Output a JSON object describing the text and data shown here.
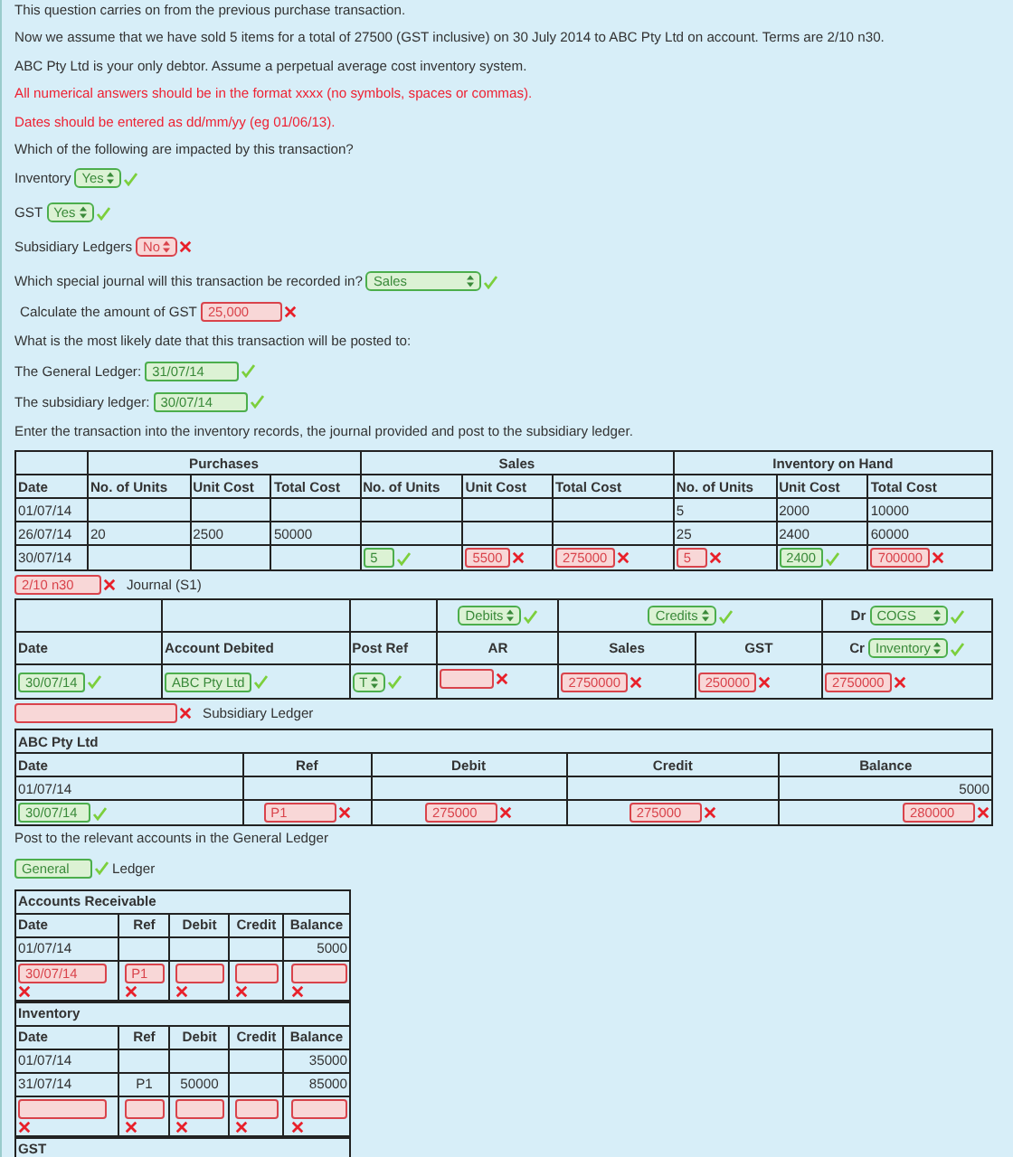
{
  "intro": [
    {
      "text": "This question carries on from the previous purchase transaction.",
      "kind": "plain"
    },
    {
      "text": "Now we assume that we have sold 5 items for a total of 27500 (GST inclusive) on 30 July 2014 to ABC Pty Ltd on account. Terms are 2/10 n30.",
      "kind": "plain"
    },
    {
      "text": "ABC Pty Ltd is your only debtor. Assume a perpetual average cost inventory system.",
      "kind": "plain"
    },
    {
      "text": "All numerical answers should be in the format xxxx (no symbols, spaces or commas).",
      "kind": "warning"
    },
    {
      "text": "Dates should be entered as dd/mm/yy (eg 01/06/13).",
      "kind": "warning"
    },
    {
      "text": "Which of the following are impacted by this transaction?",
      "kind": "plain"
    }
  ],
  "impacts": [
    {
      "label": "Inventory",
      "answer": {
        "kind": "select",
        "value": "Yes",
        "correct": true
      }
    },
    {
      "label": "GST",
      "answer": {
        "kind": "select",
        "value": "Yes",
        "correct": true
      }
    },
    {
      "label": "Subsidiary Ledgers",
      "answer": {
        "kind": "select",
        "value": "No",
        "correct": false
      }
    }
  ],
  "journal_question": {
    "label": "Which special journal will this transaction be recorded in?",
    "answer": {
      "kind": "select",
      "value": "Sales",
      "correct": true
    }
  },
  "gst_question": {
    "label": "Calculate the amount of GST",
    "answer": {
      "kind": "input",
      "value": "25,000",
      "correct": false
    }
  },
  "date_question": "What is the most likely date that this transaction will be posted to:",
  "posting_dates": [
    {
      "label": "The General Ledger:",
      "answer": {
        "kind": "input",
        "value": "31/07/14",
        "correct": true
      }
    },
    {
      "label": "The subsidiary ledger:",
      "answer": {
        "kind": "input",
        "value": "30/07/14",
        "correct": true
      }
    }
  ],
  "instruction": "Enter the transaction into the inventory records, the journal provided and post to the subsidiary ledger.",
  "inventory_table": {
    "groups": [
      "Purchases",
      "Sales",
      "Inventory on Hand"
    ],
    "columns": [
      "Date",
      "No. of Units",
      "Unit Cost",
      "Total Cost",
      "No. of Units",
      "Unit Cost",
      "Total Cost",
      "No. of Units",
      "Unit Cost",
      "Total Cost"
    ],
    "rows": [
      [
        "01/07/14",
        null,
        null,
        null,
        null,
        null,
        null,
        "5",
        "2000",
        "10000"
      ],
      [
        "26/07/14",
        "20",
        "2500",
        "50000",
        null,
        null,
        null,
        "25",
        "2400",
        "60000"
      ],
      [
        "30/07/14",
        null,
        null,
        null,
        {
          "kind": "input",
          "value": "5",
          "correct": true
        },
        {
          "kind": "input",
          "value": "5500",
          "correct": false
        },
        {
          "kind": "input",
          "value": "275000",
          "correct": false
        },
        {
          "kind": "input",
          "value": "5",
          "correct": false
        },
        {
          "kind": "input",
          "value": "2400",
          "correct": true
        },
        {
          "kind": "input",
          "value": "700000",
          "correct": false
        }
      ]
    ]
  },
  "terms_answer": {
    "kind": "input",
    "value": "2/10 n30",
    "correct": false
  },
  "journal_label": "Journal (S1)",
  "journal": {
    "columns": [
      "Date",
      "Account Debited",
      "Post Ref",
      "AR",
      "Sales",
      "GST"
    ],
    "debit_group": {
      "kind": "select",
      "value": "Debits",
      "correct": true
    },
    "credit_group": {
      "kind": "select",
      "value": "Credits",
      "correct": true
    },
    "dr_label": "Dr",
    "dr_answer": {
      "kind": "select",
      "value": "COGS",
      "correct": true
    },
    "cr_label": "Cr",
    "cr_answer": {
      "kind": "select",
      "value": "Inventory",
      "correct": true
    },
    "row": [
      {
        "kind": "input",
        "value": "30/07/14",
        "correct": true
      },
      {
        "kind": "input",
        "value": "ABC Pty Ltd",
        "correct": true
      },
      {
        "kind": "select",
        "value": "T",
        "correct": true
      },
      {
        "kind": "input",
        "correct": false
      },
      {
        "kind": "input",
        "value": "2750000",
        "correct": false
      },
      {
        "kind": "input",
        "value": "250000",
        "correct": false
      },
      {
        "kind": "input",
        "value": "2750000",
        "correct": false
      }
    ]
  },
  "subsidiary_answer": {
    "kind": "input",
    "correct": false
  },
  "subsidiary_label": "Subsidiary Ledger",
  "debtor_ledger": {
    "title": "ABC Pty Ltd",
    "columns": [
      "Date",
      "Ref",
      "Debit",
      "Credit",
      "Balance"
    ],
    "rows": [
      [
        "01/07/14",
        null,
        null,
        null,
        "5000"
      ],
      [
        {
          "kind": "input",
          "value": "30/07/14",
          "correct": true
        },
        {
          "kind": "input",
          "value": "P1",
          "correct": false
        },
        {
          "kind": "input",
          "value": "275000",
          "correct": false
        },
        {
          "kind": "input",
          "value": "275000",
          "correct": false
        },
        {
          "kind": "input",
          "value": "280000",
          "correct": false
        }
      ]
    ]
  },
  "general_prompt": "Post to the relevant accounts in the General Ledger",
  "ledger_answer": {
    "kind": "input",
    "value": "General",
    "correct": true
  },
  "ledger_label": "Ledger",
  "general_ledgers": [
    {
      "title": "Accounts Receivable",
      "columns": [
        "Date",
        "Ref",
        "Debit",
        "Credit",
        "Balance"
      ],
      "rows": [
        [
          "01/07/14",
          null,
          null,
          null,
          "5000"
        ],
        [
          {
            "kind": "input",
            "value": "30/07/14",
            "correct": false
          },
          {
            "kind": "input",
            "value": "P1",
            "correct": false
          },
          {
            "kind": "input",
            "correct": false
          },
          {
            "kind": "input",
            "correct": false
          },
          {
            "kind": "input",
            "correct": false
          }
        ]
      ]
    },
    {
      "title": "Inventory",
      "columns": [
        "Date",
        "Ref",
        "Debit",
        "Credit",
        "Balance"
      ],
      "rows": [
        [
          "01/07/14",
          null,
          null,
          null,
          "35000"
        ],
        [
          "31/07/14",
          "P1",
          "50000",
          null,
          "85000"
        ],
        [
          {
            "kind": "input",
            "correct": false
          },
          {
            "kind": "input",
            "correct": false
          },
          {
            "kind": "input",
            "correct": false
          },
          {
            "kind": "input",
            "correct": false
          },
          {
            "kind": "input",
            "correct": false
          }
        ]
      ]
    },
    {
      "title": "GST"
    }
  ]
}
